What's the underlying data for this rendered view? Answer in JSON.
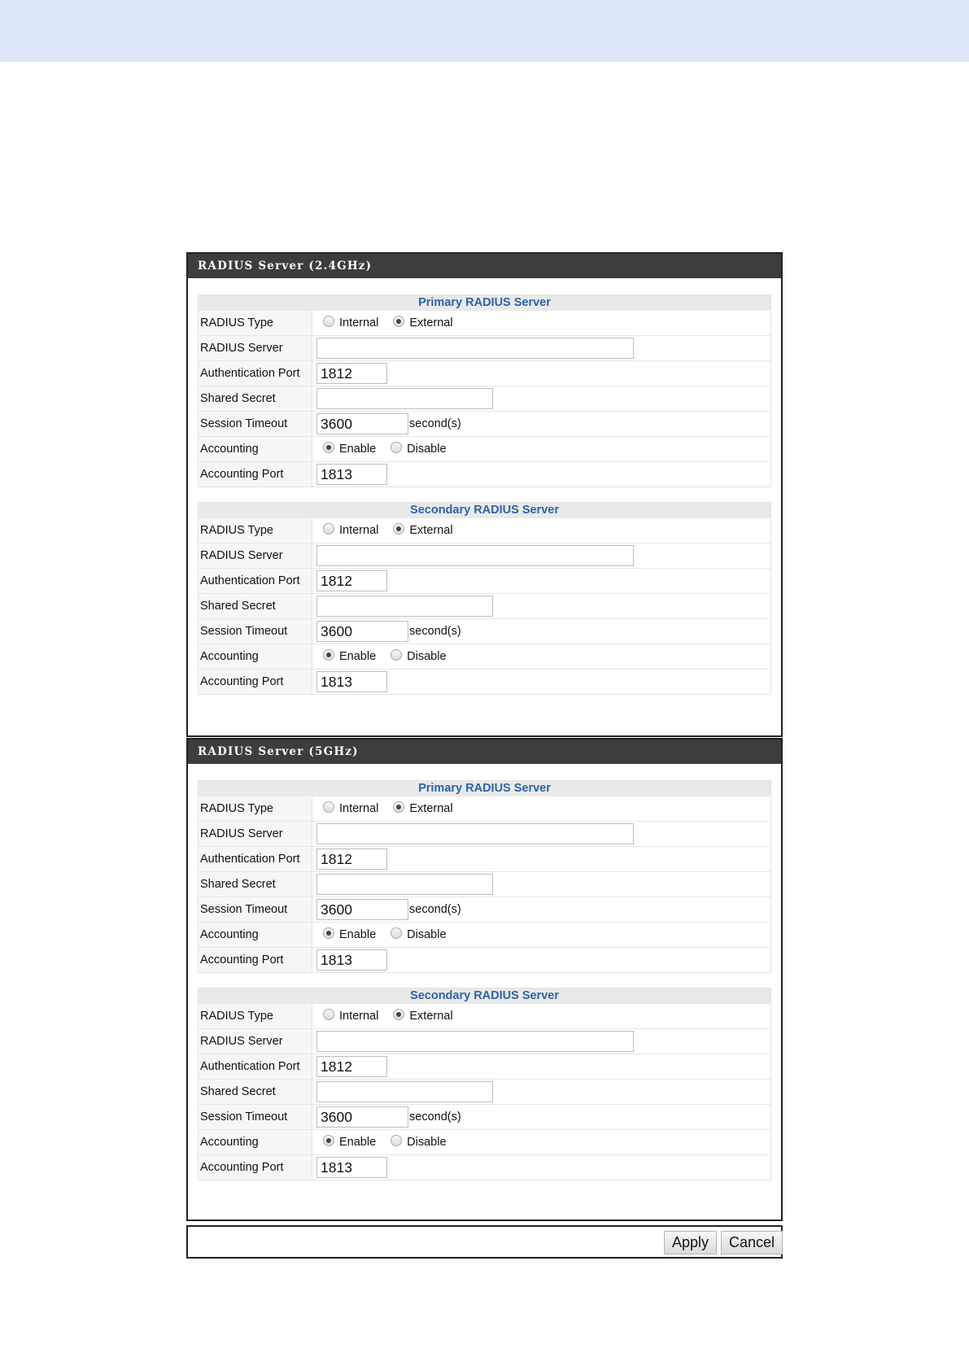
{
  "panels": [
    {
      "header": "RADIUS Server (2.4GHz)",
      "sections": [
        {
          "title": "Primary RADIUS Server",
          "labels": [
            "RADIUS Type",
            "RADIUS Server",
            "Authentication Port",
            "Shared Secret",
            "Session Timeout",
            "Accounting",
            "Accounting Port"
          ],
          "type_options": [
            "Internal",
            "External"
          ],
          "type_selected": "External",
          "server": "",
          "auth_port": "1812",
          "secret": "",
          "timeout": "3600",
          "timeout_unit": "second(s)",
          "acct_options": [
            "Enable",
            "Disable"
          ],
          "acct_selected": "Enable",
          "acct_port": "1813"
        },
        {
          "title": "Secondary RADIUS Server",
          "labels": [
            "RADIUS Type",
            "RADIUS Server",
            "Authentication Port",
            "Shared Secret",
            "Session Timeout",
            "Accounting",
            "Accounting Port"
          ],
          "type_options": [
            "Internal",
            "External"
          ],
          "type_selected": "External",
          "server": "",
          "auth_port": "1812",
          "secret": "",
          "timeout": "3600",
          "timeout_unit": "second(s)",
          "acct_options": [
            "Enable",
            "Disable"
          ],
          "acct_selected": "Enable",
          "acct_port": "1813"
        }
      ]
    },
    {
      "header": "RADIUS Server (5GHz)",
      "sections": [
        {
          "title": "Primary RADIUS Server",
          "labels": [
            "RADIUS Type",
            "RADIUS Server",
            "Authentication Port",
            "Shared Secret",
            "Session Timeout",
            "Accounting",
            "Accounting Port"
          ],
          "type_options": [
            "Internal",
            "External"
          ],
          "type_selected": "External",
          "server": "",
          "auth_port": "1812",
          "secret": "",
          "timeout": "3600",
          "timeout_unit": "second(s)",
          "acct_options": [
            "Enable",
            "Disable"
          ],
          "acct_selected": "Enable",
          "acct_port": "1813"
        },
        {
          "title": "Secondary RADIUS Server",
          "labels": [
            "RADIUS Type",
            "RADIUS Server",
            "Authentication Port",
            "Shared Secret",
            "Session Timeout",
            "Accounting",
            "Accounting Port"
          ],
          "type_options": [
            "Internal",
            "External"
          ],
          "type_selected": "External",
          "server": "",
          "auth_port": "1812",
          "secret": "",
          "timeout": "3600",
          "timeout_unit": "second(s)",
          "acct_options": [
            "Enable",
            "Disable"
          ],
          "acct_selected": "Enable",
          "acct_port": "1813"
        }
      ]
    }
  ],
  "footer": {
    "apply_label": "Apply",
    "cancel_label": "Cancel"
  }
}
